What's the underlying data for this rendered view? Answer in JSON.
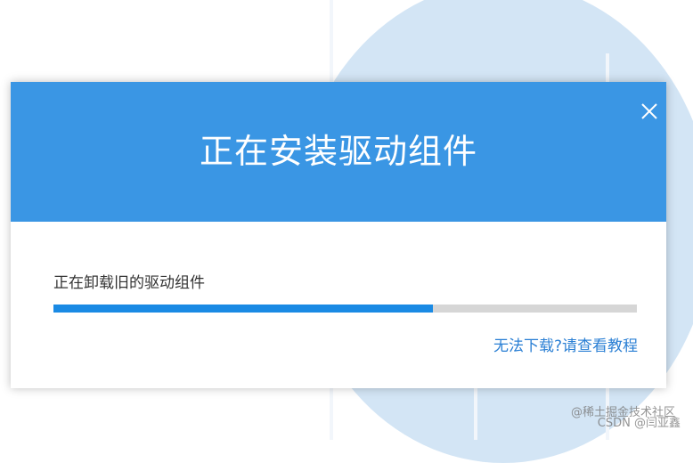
{
  "dialog": {
    "title": "正在安装驱动组件",
    "status": "正在卸载旧的驱动组件",
    "progress_fraction": 0.65,
    "help_prefix": "无法下载?",
    "help_link": "请查看教程",
    "close_icon": "close-icon"
  },
  "watermark": {
    "line1": "@稀土掘金技术社区",
    "line2": "CSDN @闫亚鑫"
  },
  "colors": {
    "header_bg": "#3a96e4",
    "progress_fill": "#1a8ae4",
    "progress_track": "#d6d6d6",
    "link": "#2a7fd4",
    "background_circle": "#d3e5f5"
  }
}
